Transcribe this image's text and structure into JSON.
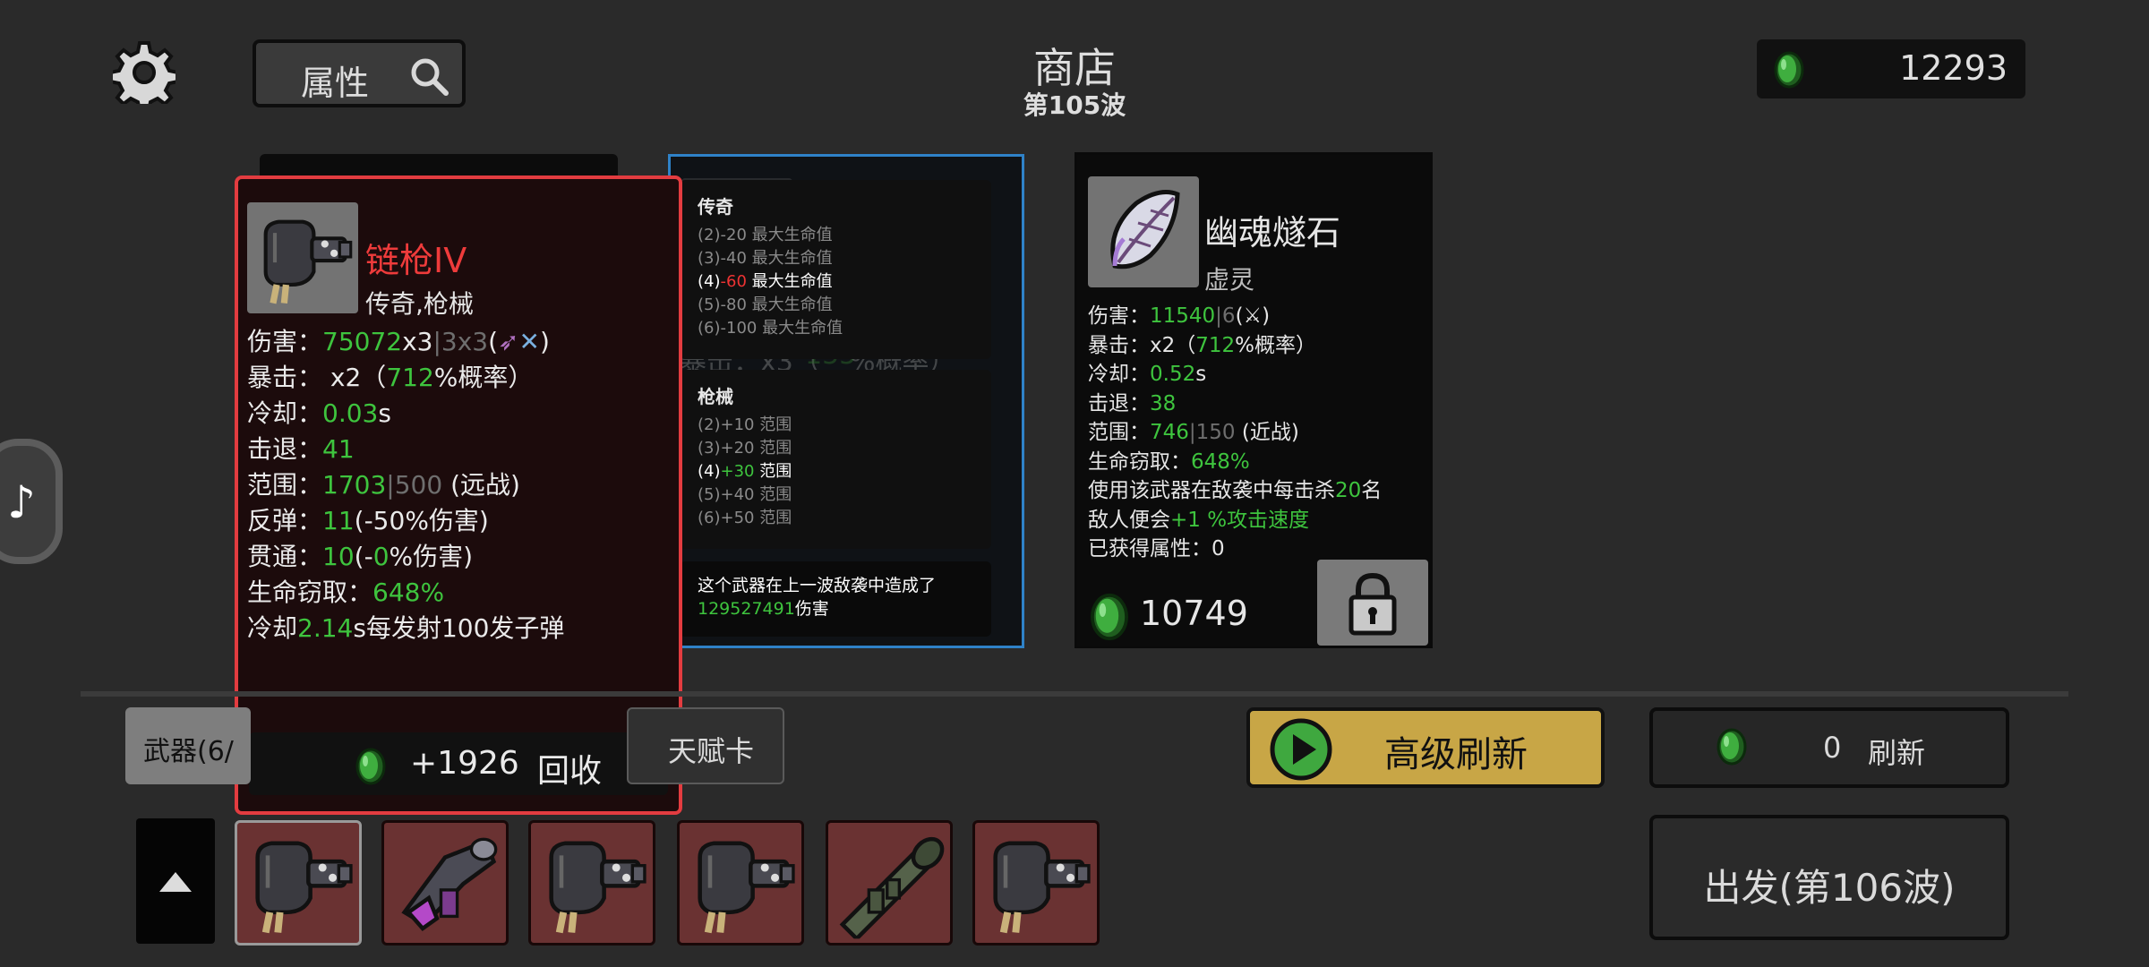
{
  "header": {
    "search_label": "属性",
    "title": "商店",
    "wave": "第105波",
    "gold": "12293"
  },
  "card1": {},
  "card2": {
    "trait_legend": {
      "title": "传奇",
      "lines": [
        {
          "pre": "(2)",
          "num": "-20",
          "txt": " 最大生命值"
        },
        {
          "pre": "(3)",
          "num": "-40",
          "txt": " 最大生命值"
        },
        {
          "pre": "(4)",
          "num": "-60",
          "txt": " 最大生命值"
        },
        {
          "pre": "(5)",
          "num": "-80",
          "txt": " 最大生命值"
        },
        {
          "pre": "(6)",
          "num": "-100",
          "txt": " 最大生命值"
        }
      ]
    },
    "trait_gun": {
      "title": "枪械",
      "lines": [
        {
          "pre": "(2)",
          "num": "+10",
          "txt": " 范围"
        },
        {
          "pre": "(3)",
          "num": "+20",
          "txt": " 范围"
        },
        {
          "pre": "(4)",
          "num": "+30",
          "txt": " 范围"
        },
        {
          "pre": "(5)",
          "num": "+40",
          "txt": " 范围"
        },
        {
          "pre": "(6)",
          "num": "+50",
          "txt": " 范围"
        }
      ]
    },
    "note_text": "这个武器在上一波敌袭中造成了",
    "note_value": "129527491",
    "note_suffix": "伤害"
  },
  "card3": {
    "name": "幽魂燧石",
    "type": "虚灵",
    "damage_label": "伤害：",
    "damage_value": "11540",
    "damage_base": "6",
    "crit_label": "暴击：",
    "crit_mult": "x2（",
    "crit_value": "712",
    "crit_suffix": "%概率）",
    "cooldown_label": "冷却：",
    "cooldown_value": "0.52",
    "cooldown_unit": "s",
    "knockback_label": "击退：",
    "knockback_value": "38",
    "range_label": "范围：",
    "range_value": "746",
    "range_base": "150",
    "range_type": " (近战)",
    "lifesteal_label": "生命窃取：",
    "lifesteal_value": "648%",
    "effect_line1_pre": "使用该武器在敌袭中每击杀",
    "effect_kills": "20",
    "effect_line1_post": "名",
    "effect_line2_pre": "敌人便会",
    "effect_bonus": "+1 %攻击速度",
    "earned_label": "已获得属性：",
    "earned_value": "0",
    "price": "10749"
  },
  "tooltip": {
    "name": "链枪IV",
    "tags": "传奇,枪械",
    "damage_label": "伤害：",
    "damage_value": "75072",
    "damage_mult": "x3",
    "damage_base": "3x3",
    "crit_label": "暴击：",
    "crit_mult": " x2（",
    "crit_value": "712",
    "crit_suffix": "%概率）",
    "cooldown_label": "冷却：",
    "cooldown_value": "0.03",
    "cooldown_unit": "s",
    "knockback_label": "击退：",
    "knockback_value": "41",
    "range_label": "范围：",
    "range_value": "1703",
    "range_base": "500",
    "range_type": " (远战)",
    "bounce_label": "反弹：",
    "bounce_value": "11",
    "bounce_suffix": "(-50%伤害)",
    "pierce_label": "贯通：",
    "pierce_value": "10",
    "pierce_pre": "(-",
    "pierce_pct": "0",
    "pierce_suffix": "%伤害)",
    "lifesteal_label": "生命窃取：",
    "lifesteal_value": "648%",
    "special_pre": "冷却",
    "special_value": "2.14",
    "special_post": "s每发射100发子弹",
    "recycle_amount": "+1926",
    "recycle_label": "回收"
  },
  "tabs": {
    "weapon": "武器(6/",
    "talent": "天赋卡"
  },
  "buttons": {
    "advanced_refresh": "高级刷新",
    "refresh_cost": "0",
    "refresh": "刷新",
    "depart": "出发(第106波)"
  },
  "inventory": [
    {
      "icon": "chain-gun-icon"
    },
    {
      "icon": "laser-gun-icon"
    },
    {
      "icon": "chain-gun-icon"
    },
    {
      "icon": "chain-gun-icon"
    },
    {
      "icon": "rocket-launcher-icon"
    },
    {
      "icon": "chain-gun-icon"
    }
  ],
  "colors": {
    "accent_green": "#3ec43e",
    "tooltip_border": "#e33c40",
    "selected_card_border": "#2f82c8",
    "advanced_refresh_bg": "#c8a646"
  }
}
